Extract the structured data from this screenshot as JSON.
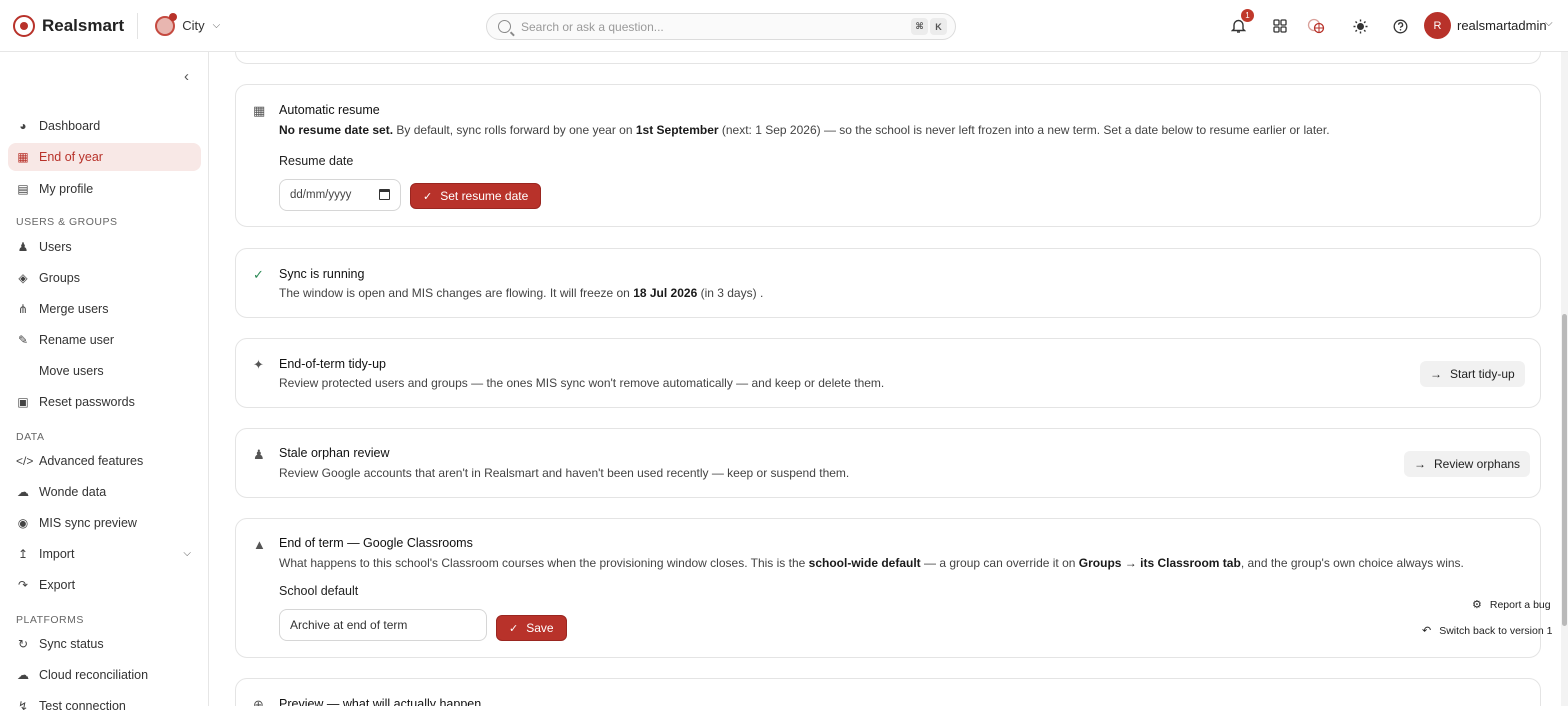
{
  "app": {
    "brand": "Realsmart",
    "school": "City"
  },
  "search": {
    "placeholder": "Search or ask a question...",
    "kbd1": "⌘",
    "kbd2": "K"
  },
  "topbar": {
    "notification_count": "1",
    "user_initial": "R",
    "username": "realsmartadmin"
  },
  "sidebar": {
    "items": [
      {
        "label": "Dashboard",
        "icon": "dashboard-icon"
      },
      {
        "label": "End of year",
        "icon": "calendar-icon",
        "active": true
      },
      {
        "label": "My profile",
        "icon": "id-card-icon"
      }
    ],
    "users_groups_heading": "USERS & GROUPS",
    "users_groups": [
      {
        "label": "Users",
        "icon": "users-icon"
      },
      {
        "label": "Groups",
        "icon": "layers-icon"
      },
      {
        "label": "Merge users",
        "icon": "merge-icon"
      },
      {
        "label": "Rename user",
        "icon": "rename-icon"
      },
      {
        "label": "Move users",
        "icon": ""
      },
      {
        "label": "Reset passwords",
        "icon": "lock-icon"
      }
    ],
    "data_heading": "DATA",
    "data": [
      {
        "label": "Advanced features",
        "icon": "code-icon"
      },
      {
        "label": "Wonde data",
        "icon": "cloud-download-icon"
      },
      {
        "label": "MIS sync preview",
        "icon": "eye-icon"
      },
      {
        "label": "Import",
        "icon": "upload-icon"
      },
      {
        "label": "Export",
        "icon": "export-icon"
      }
    ],
    "platforms_heading": "PLATFORMS",
    "platforms": [
      {
        "label": "Sync status",
        "icon": "sync-icon"
      },
      {
        "label": "Cloud reconciliation",
        "icon": "cloud-icon"
      },
      {
        "label": "Test connection",
        "icon": "plug-icon"
      }
    ]
  },
  "resume": {
    "title": "Automatic resume",
    "desc_bold1": "No resume date set.",
    "desc_1": " By default, sync rolls forward by one year on ",
    "desc_bold2": "1st September",
    "desc_2": " (next: 1 Sep 2026) — so the school is never left frozen into a new term. Set a date below to resume earlier or later.",
    "field_label": "Resume date",
    "date_placeholder": "dd/mm/yyyy",
    "button": "Set resume date"
  },
  "sync": {
    "title": "Sync is running",
    "desc_1": "The window is open and MIS changes are flowing. It will freeze on ",
    "desc_bold": "18 Jul 2026",
    "desc_2": " (in 3 days) ."
  },
  "tidyup": {
    "title": "End-of-term tidy-up",
    "desc": "Review protected users and groups — the ones MIS sync won't remove automatically — and keep or delete them.",
    "button": "Start tidy-up"
  },
  "orphan": {
    "title": "Stale orphan review",
    "desc": "Review Google accounts that aren't in Realsmart and haven't been used recently — keep or suspend them.",
    "button": "Review orphans"
  },
  "classroom": {
    "title": "End of term — Google Classrooms",
    "desc_1": "What happens to this school's Classroom courses when the provisioning window closes. This is the ",
    "desc_bold1": "school-wide default",
    "desc_2": " — a group can override it on ",
    "desc_bold2": "Groups → its Classroom tab",
    "desc_3": ", and the group's own choice always wins.",
    "field_label": "School default",
    "select_value": "Archive at end of term",
    "button": "Save"
  },
  "preview": {
    "title": "Preview — what will actually happen"
  },
  "floating": {
    "report_bug": "Report a bug",
    "switch_back": "Switch back to version 1"
  }
}
